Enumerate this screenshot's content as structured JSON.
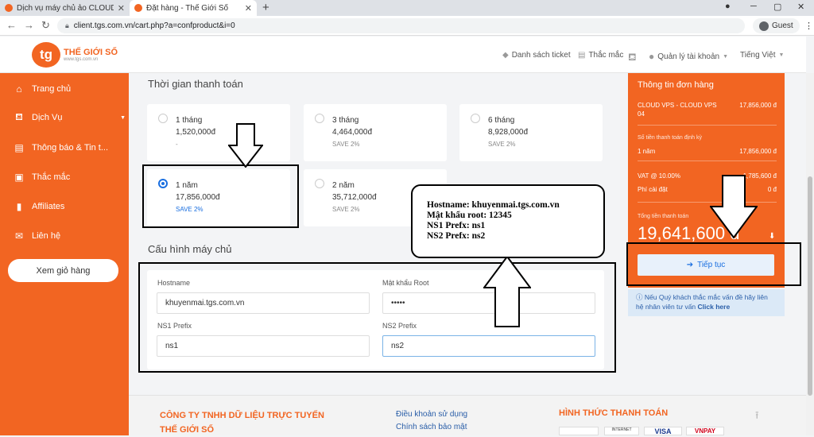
{
  "browser": {
    "tabs": [
      {
        "title": "Dịch vụ máy chủ ảo CLOUD VPS",
        "close": "✕"
      },
      {
        "title": "Đặt hàng - Thế Giới Số",
        "close": "✕"
      }
    ],
    "new_tab": "+",
    "url": "client.tgs.com.vn/cart.php?a=confproduct&i=0",
    "profile": "Guest"
  },
  "header": {
    "logo_mark": "tg",
    "logo_name": "THẾ GIỚI SỐ",
    "logo_sub": "www.tgs.com.vn",
    "nav": {
      "tickets": "Danh sách ticket",
      "faq": "Thắc mắc",
      "account": "Quản lý tài khoản",
      "language": "Tiếng Việt"
    }
  },
  "sidebar": {
    "items": [
      {
        "label": "Trang chủ",
        "icon": "home-icon"
      },
      {
        "label": "Dịch Vụ",
        "icon": "basket-icon"
      },
      {
        "label": "Thông báo & Tin t...",
        "icon": "document-icon"
      },
      {
        "label": "Thắc mắc",
        "icon": "question-icon"
      },
      {
        "label": "Affiliates",
        "icon": "bar-chart-icon"
      },
      {
        "label": "Liên hệ",
        "icon": "envelope-icon"
      }
    ],
    "cart_button": "Xem giỏ hàng"
  },
  "billing": {
    "title": "Thời gian thanh toán",
    "plans": [
      {
        "term": "1 tháng",
        "price": "1,520,000đ",
        "note": "-",
        "selected": false
      },
      {
        "term": "3 tháng",
        "price": "4,464,000đ",
        "note": "SAVE 2%",
        "selected": false
      },
      {
        "term": "6 tháng",
        "price": "8,928,000đ",
        "note": "SAVE 2%",
        "selected": false
      },
      {
        "term": "1 năm",
        "price": "17,856,000đ",
        "note": "SAVE 2%",
        "selected": true
      },
      {
        "term": "2 năm",
        "price": "35,712,000đ",
        "note": "SAVE 2%",
        "selected": false
      }
    ]
  },
  "config": {
    "title": "Cấu hình máy chủ",
    "hostname_label": "Hostname",
    "hostname_value": "khuyenmai.tgs.com.vn",
    "password_label": "Mật khẩu Root",
    "password_value": "•••••",
    "ns1_label": "NS1 Prefix",
    "ns1_value": "ns1",
    "ns2_label": "NS2 Prefix",
    "ns2_value": "ns2"
  },
  "callout": {
    "lines": [
      "Hostname: khuyenmai.tgs.com.vn",
      "Mật khẩu root: 12345",
      "NS1 Prefx: ns1",
      "NS2 Prefx: ns2"
    ]
  },
  "order": {
    "title": "Thông tin đơn hàng",
    "product": "CLOUD VPS - CLOUD VPS 04",
    "product_price": "17,856,000 đ",
    "recurring_label": "Số tiền thanh toán định kỳ",
    "period": "1 năm",
    "period_price": "17,856,000 đ",
    "vat_label": "VAT @ 10.00%",
    "vat_value": "1,785,600 đ",
    "setup_label": "Phí cài đặt",
    "setup_value": "0 đ",
    "total_label": "Tổng tiền thanh toán",
    "total_value": "19,641,600 đ",
    "continue_button": "Tiếp tục",
    "help_text": "Nếu Quý khách thắc mắc vấn đề hãy liên hệ nhân viên tư vấn",
    "help_link": "Click here"
  },
  "footer": {
    "company_line1": "CÔNG TY TNHH DỮ LIỆU TRỰC TUYẾN",
    "company_line2": "THẾ GIỚI SỐ",
    "link1": "Điều khoản sử dụng",
    "link2": "Chính sách bảo mật",
    "payment_title": "HÌNH THỨC THANH TOÁN",
    "pay_logos": [
      "INTERNET",
      "VISA",
      "VNPAY"
    ]
  },
  "colors": {
    "brand": "#f26522",
    "accent": "#1a6fe0"
  }
}
